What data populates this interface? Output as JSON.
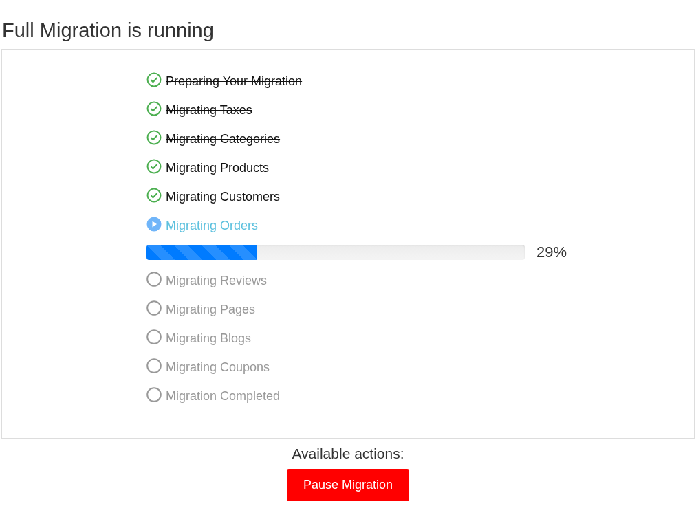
{
  "title": "Full Migration is running",
  "steps": [
    {
      "label": "Preparing Your Migration",
      "kind": "done"
    },
    {
      "label": "Migrating Taxes",
      "kind": "done"
    },
    {
      "label": "Migrating Categories",
      "kind": "done"
    },
    {
      "label": "Migrating Products",
      "kind": "done"
    },
    {
      "label": "Migrating Customers",
      "kind": "done"
    },
    {
      "label": "Migrating Orders",
      "kind": "running",
      "progress": {
        "level": 0.29,
        "reading": "29%"
      }
    },
    {
      "label": "Migrating Reviews",
      "kind": "pending"
    },
    {
      "label": "Migrating Pages",
      "kind": "pending"
    },
    {
      "label": "Migrating Blogs",
      "kind": "pending"
    },
    {
      "label": "Migrating Coupons",
      "kind": "pending"
    },
    {
      "label": "Migration Completed",
      "kind": "pending"
    }
  ],
  "actions": {
    "heading": "Available actions:",
    "buttons": [
      "Pause Migration"
    ]
  }
}
